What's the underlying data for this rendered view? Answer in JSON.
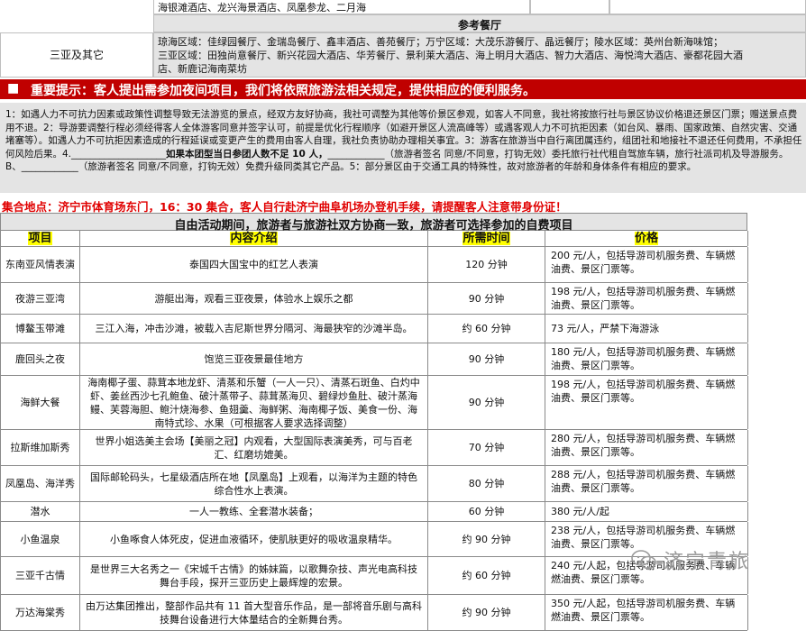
{
  "top": {
    "row1_text": "海银滩酒店、龙兴海景酒店、凤凰参龙、二月海",
    "dining_heading": "参考餐厅",
    "region_label": "三亚及其它",
    "dining_line1": "琼海区域：佳绿园餐厅、金瑞岛餐厅、鑫丰酒店、善苑餐厅；万宁区域：大茂乐游餐厅、晶远餐厅；陵水区域：英州台新海味馆；",
    "dining_line2": "三亚区域：田独尚意餐厅、新兴花园大酒店、华芳餐厅、景利莱大酒店、海上明月大酒店、智力大酒店、海悦湾大酒店、豪都花园大酒",
    "dining_line3": "店、新鹿记海南菜坊"
  },
  "notice": {
    "marker": "■",
    "text": "重要提示：客人提出需参加夜间项目，我们将依照旅游法相关规定，提供相应的便利服务。"
  },
  "terms": {
    "p1": "1：如遇人力不可抗力因素或政策性调整导致无法游览的景点，经双方友好协商，我社可调整为其他等价景区参观，如客人不同意，我社将按旅行社与景区协议价格退还景区门票；赠送景点费用不退。2：导游要调整行程必须经得客人全体游客同意并签字认可，前提是优化行程顺序（如避开景区人流高峰等）或遇客观人力不可抗拒因素（如台风、暴雨、国家政策、自然灾害、交通堵塞等）。如遇人力不可抗拒因素造成的行程延误或变更产生的费用由客人自理，我社负责协助办理相关事宜。3：游客在旅游当中自行离团属违约，组团社和地接社不退还任何费用，不承担任何风险后果。4.",
    "fill_blank": "____________________",
    "bold_part": "如果本团型当日参团人数不足 10 人，",
    "sign1": "____________（旅游者签名 同意/不同意，打钩无效）委托旅行社代租自驾旅车辆，旅行社派司机及导游服务。B、",
    "sign2": "____________（旅游者签名 同意/不同意，打钩无效）免费升级同类其它产品。",
    "p5": "5：部分景区由于交通工具的特殊性，故对旅游者的年龄和身体条件有相应的要求。"
  },
  "meeting_point": "集合地点：济宁市体育场东门，16：30 集合，客人自行赴济宁曲阜机场办登机手续，请提醒客人注意带身份证！",
  "activities": {
    "title": "自由活动期间，旅游者与旅游社双方协商一致，旅游者可选择参加的自费项目",
    "headers": [
      "项目",
      "内容介绍",
      "所需时间",
      "价格"
    ],
    "rows": [
      {
        "name": "东南亚风情表演",
        "desc": "泰国四大国宝中的红艺人表演",
        "time": "120 分钟",
        "price": "200 元/人，包括导游司机服务费、车辆燃油费、景区门票等。"
      },
      {
        "name": "夜游三亚湾",
        "desc": "游艇出海，观看三亚夜景，体验水上娱乐之都",
        "time": "90 分钟",
        "price": "198 元/人，包括导游司机服务费、车辆燃油费、景区门票等。"
      },
      {
        "name": "博鳌玉带滩",
        "desc": "三江入海，冲击沙滩，被载入吉尼斯世界分隔河、海最狭窄的沙滩半岛。",
        "time": "约 60 分钟",
        "price": "73 元/人，严禁下海游泳"
      },
      {
        "name": "鹿回头之夜",
        "desc": "饱览三亚夜景最佳地方",
        "time": "90 分钟",
        "price": "180 元/人，包括导游司机服务费、车辆燃油费、景区门票等。"
      },
      {
        "name": "海鲜大餐",
        "desc": "海南椰子蛋、蒜茸本地龙虾、清蒸和乐蟹（一人一只）、清蒸石斑鱼、白灼中虾、姜丝西沙七孔鲍鱼、破汁蒸带子、蒜茸蒸海贝、碧绿炒鱼肚、破汁蒸海鳗、芙蓉海胆、鲍汁烧海参、鱼翅羹、海鲜粥、海南椰子饭、美食一份、海南特式珍、水果（可根据客人要求选择调整）",
        "time": "90 分钟",
        "price": "198 元/人，包括导游司机服务费、车辆燃油费、景区门票等。"
      },
      {
        "name": "拉斯维加斯秀",
        "desc": "世界小姐选美主会场【美丽之冠】内观看，大型国际表演美秀，可与百老汇、红磨坊媲美。",
        "time": "70 分钟",
        "price": "280 元/人，包括导游司机服务费、车辆燃油费、景区门票等。"
      },
      {
        "name": "凤凰岛、海洋秀",
        "desc": "国际邮轮码头，七星级酒店所在地【凤凰岛】上观看，以海洋为主题的特色综合性水上表演。",
        "time": "80 分钟",
        "price": "288 元/人，包括导游司机服务费、车辆燃油费、景区门票等。"
      },
      {
        "name": "潜水",
        "desc": "一人一教练、全套潜水装备；",
        "time": "60 分钟",
        "price": "380 元/人/起"
      },
      {
        "name": "小鱼温泉",
        "desc": "小鱼啄食人体死皮，促进血液循环，使肌肤更好的吸收温泉精华。",
        "time": "约 90 分钟",
        "price": "238 元/人，包括导游司机服务费、车辆燃油费、景区门票等。"
      },
      {
        "name": "三亚千古情",
        "desc": "是世界三大名秀之一《宋城千古情》的姊妹篇，以歌舞杂技、声光电高科技舞台手段，探开三亚历史上最辉煌的宏景。",
        "time": "约 60 分钟",
        "price": "240 元/人起，包括导游司机服务费、车辆燃油费、景区门票等。"
      },
      {
        "name": "万达海棠秀",
        "desc": "由万达集团推出，整部作品共有 11 首大型音乐作品，是一部将音乐剧与高科技舞台设备进行大体量结合的全新舞台秀。",
        "time": "约 90 分钟",
        "price": "350 元/人起，包括导游司机服务费、车辆燃油费、景区门票等。"
      }
    ]
  },
  "watermark": "济宁青旅"
}
